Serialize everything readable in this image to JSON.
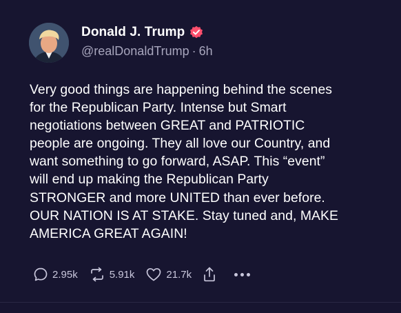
{
  "author": {
    "display_name": "Donald J. Trump",
    "handle": "@realDonaldTrump",
    "separator": "·",
    "time_ago": "6h",
    "verified_icon": "verified-badge-icon"
  },
  "post": {
    "text": "Very good things are happening behind the scenes\nfor the Republican Party. Intense but Smart\nnegotiations between GREAT and PATRIOTIC\npeople are ongoing. They all love our Country, and\nwant something to go forward, ASAP. This “event”\nwill end up making the Republican Party\nSTRONGER and more UNITED than ever before.\nOUR NATION IS AT STAKE. Stay tuned and, MAKE\nAMERICA GREAT AGAIN!"
  },
  "actions": {
    "replies": "2.95k",
    "reposts": "5.91k",
    "likes": "21.7k"
  },
  "colors": {
    "background": "#171530",
    "text": "#ffffff",
    "muted": "#a8a6bd",
    "verified": "#ff4f6d"
  }
}
